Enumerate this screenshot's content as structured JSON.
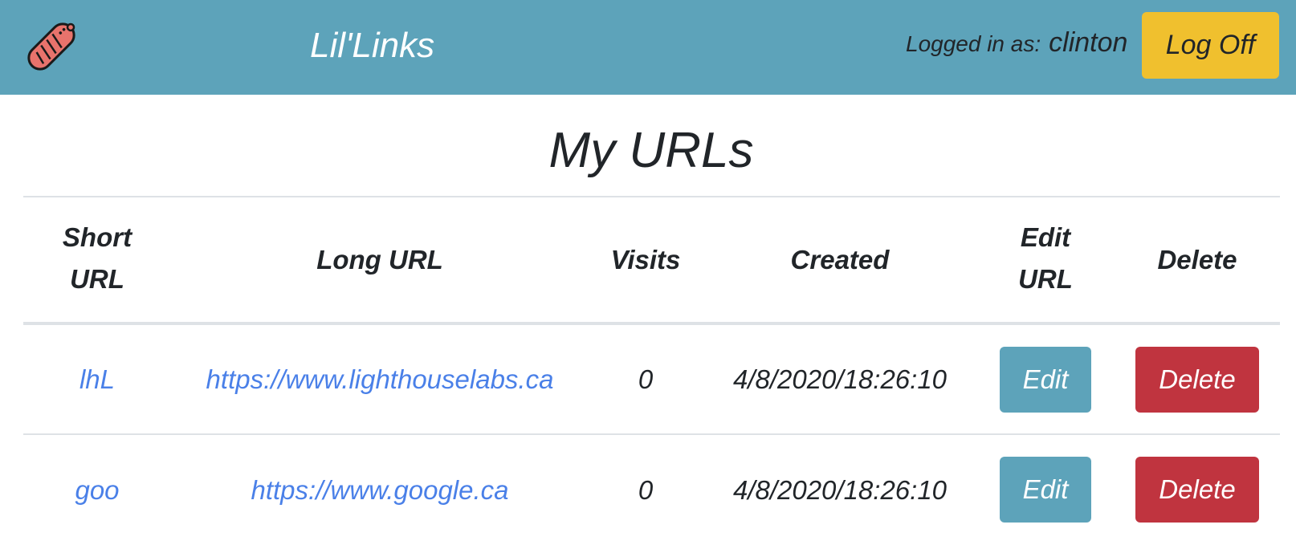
{
  "app": {
    "brand": "Lil'Links",
    "logo_icon": "sausage-icon",
    "colors": {
      "nav_bg": "#5da3ba",
      "logoff_bg": "#f0c02e",
      "link": "#4a80e8",
      "edit_bg": "#5da3ba",
      "delete_bg": "#c0343f"
    }
  },
  "header": {
    "logged_in_label": "Logged in as:",
    "username": "clinton",
    "logoff_label": "Log Off"
  },
  "main": {
    "title": "My URLs",
    "columns": {
      "short": [
        "Short",
        "URL"
      ],
      "long": "Long URL",
      "visits": "Visits",
      "created": "Created",
      "edit": [
        "Edit",
        "URL"
      ],
      "delete": "Delete"
    },
    "rows": [
      {
        "short": "lhL",
        "long": "https://www.lighthouselabs.ca",
        "visits": "0",
        "created": "4/8/2020/18:26:10",
        "edit_label": "Edit",
        "delete_label": "Delete"
      },
      {
        "short": "goo",
        "long": "https://www.google.ca",
        "visits": "0",
        "created": "4/8/2020/18:26:10",
        "edit_label": "Edit",
        "delete_label": "Delete"
      }
    ]
  }
}
